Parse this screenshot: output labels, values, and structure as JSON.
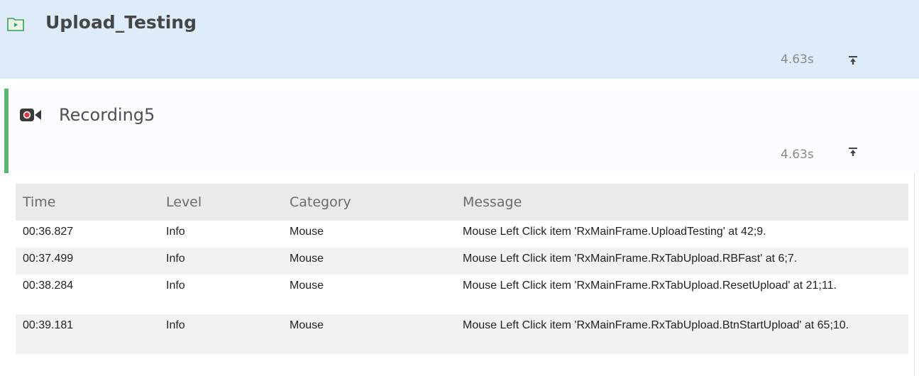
{
  "suite": {
    "title": "Upload_Testing",
    "duration": "4.63s",
    "icon": "play-folder-icon",
    "collapse_icon": "collapse-up-icon",
    "background_color": "#deebf8"
  },
  "recording": {
    "title": "Recording5",
    "duration": "4.63s",
    "icon": "recording-icon",
    "collapse_icon": "collapse-up-icon",
    "accent_color": "#5ab573"
  },
  "log": {
    "columns": [
      "Time",
      "Level",
      "Category",
      "Message"
    ],
    "rows": [
      {
        "time": "00:36.827",
        "level": "Info",
        "category": "Mouse",
        "message": "Mouse Left Click item 'RxMainFrame.UploadTesting' at 42;9."
      },
      {
        "time": "00:37.499",
        "level": "Info",
        "category": "Mouse",
        "message": "Mouse Left Click item 'RxMainFrame.RxTabUpload.RBFast' at 6;7."
      },
      {
        "time": "00:38.284",
        "level": "Info",
        "category": "Mouse",
        "message": "Mouse Left Click item 'RxMainFrame.RxTabUpload.ResetUpload' at 21;11."
      },
      {
        "time": "00:39.181",
        "level": "Info",
        "category": "Mouse",
        "message": "Mouse Left Click item 'RxMainFrame.RxTabUpload.BtnStartUpload' at 65;10."
      }
    ]
  }
}
